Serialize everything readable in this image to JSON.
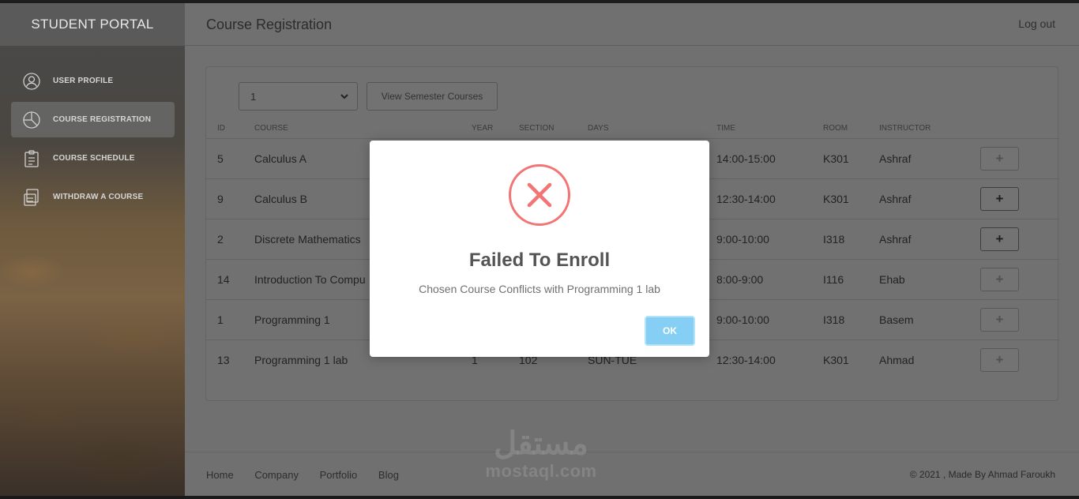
{
  "sidebar": {
    "brand": "STUDENT PORTAL",
    "items": [
      {
        "label": "USER PROFILE",
        "icon": "user-icon"
      },
      {
        "label": "COURSE REGISTRATION",
        "icon": "pie-chart-icon",
        "active": true
      },
      {
        "label": "COURSE SCHEDULE",
        "icon": "clipboard-icon"
      },
      {
        "label": "WITHDRAW A COURSE",
        "icon": "register-icon"
      }
    ]
  },
  "header": {
    "title": "Course Registration",
    "logout": "Log out"
  },
  "controls": {
    "semester_value": "1",
    "view_button": "View Semester Courses"
  },
  "table": {
    "headers": [
      "ID",
      "COURSE",
      "YEAR",
      "SECTION",
      "DAYS",
      "TIME",
      "ROOM",
      "INSTRUCTOR"
    ],
    "rows": [
      {
        "id": "5",
        "course": "Calculus A",
        "year": "",
        "section": "",
        "days": "",
        "time": "14:00-15:00",
        "room": "K301",
        "instructor": "Ashraf",
        "add": "+"
      },
      {
        "id": "9",
        "course": "Calculus B",
        "year": "",
        "section": "",
        "days": "",
        "time": "12:30-14:00",
        "room": "K301",
        "instructor": "Ashraf",
        "add": "+"
      },
      {
        "id": "2",
        "course": "Discrete Mathematics",
        "year": "",
        "section": "",
        "days": "",
        "time": "9:00-10:00",
        "room": "I318",
        "instructor": "Ashraf",
        "add": "+"
      },
      {
        "id": "14",
        "course": "Introduction To Compu",
        "year": "",
        "section": "",
        "days": "",
        "time": "8:00-9:00",
        "room": "I116",
        "instructor": "Ehab",
        "add": "+"
      },
      {
        "id": "1",
        "course": "Programming 1",
        "year": "",
        "section": "",
        "days": "",
        "time": "9:00-10:00",
        "room": "I318",
        "instructor": "Basem",
        "add": "+"
      },
      {
        "id": "13",
        "course": "Programming 1 lab",
        "year": "1",
        "section": "102",
        "days": "SUN-TUE",
        "time": "12:30-14:00",
        "room": "K301",
        "instructor": "Ahmad",
        "add": "+"
      }
    ]
  },
  "footer": {
    "links": [
      "Home",
      "Company",
      "Portfolio",
      "Blog"
    ],
    "copyright": "© 2021 , Made By Ahmad Faroukh"
  },
  "watermark": {
    "arabic": "مستقل",
    "latin": "mostaql.com"
  },
  "modal": {
    "icon": "error-x-icon",
    "title": "Failed To Enroll",
    "message": "Chosen Course Conflicts with Programming 1 lab",
    "ok_label": "OK",
    "colors": {
      "error": "#f27474",
      "ok": "#86cff4"
    }
  }
}
